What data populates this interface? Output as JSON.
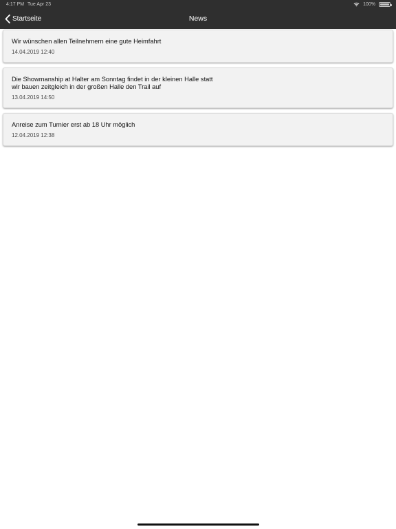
{
  "status_bar": {
    "time": "4:17 PM",
    "date": "Tue Apr 23",
    "battery": "100%"
  },
  "nav": {
    "back_label": "Startseite",
    "title": "News"
  },
  "news": [
    {
      "text": "Wir wünschen allen Teilnehmern eine gute Heimfahrt",
      "date": "14.04.2019 12:40"
    },
    {
      "text": "Die Showmanship at Halter am Sonntag findet in der kleinen Halle statt\nwir bauen zeitgleich in der großen Halle den Trail auf",
      "date": "13.04.2019 14:50"
    },
    {
      "text": "Anreise zum Turnier erst ab 18 Uhr möglich",
      "date": "12.04.2019 12:38"
    }
  ],
  "colors": {
    "bar_background": "#2f2f2f",
    "card_background": "#f2f2f2"
  }
}
